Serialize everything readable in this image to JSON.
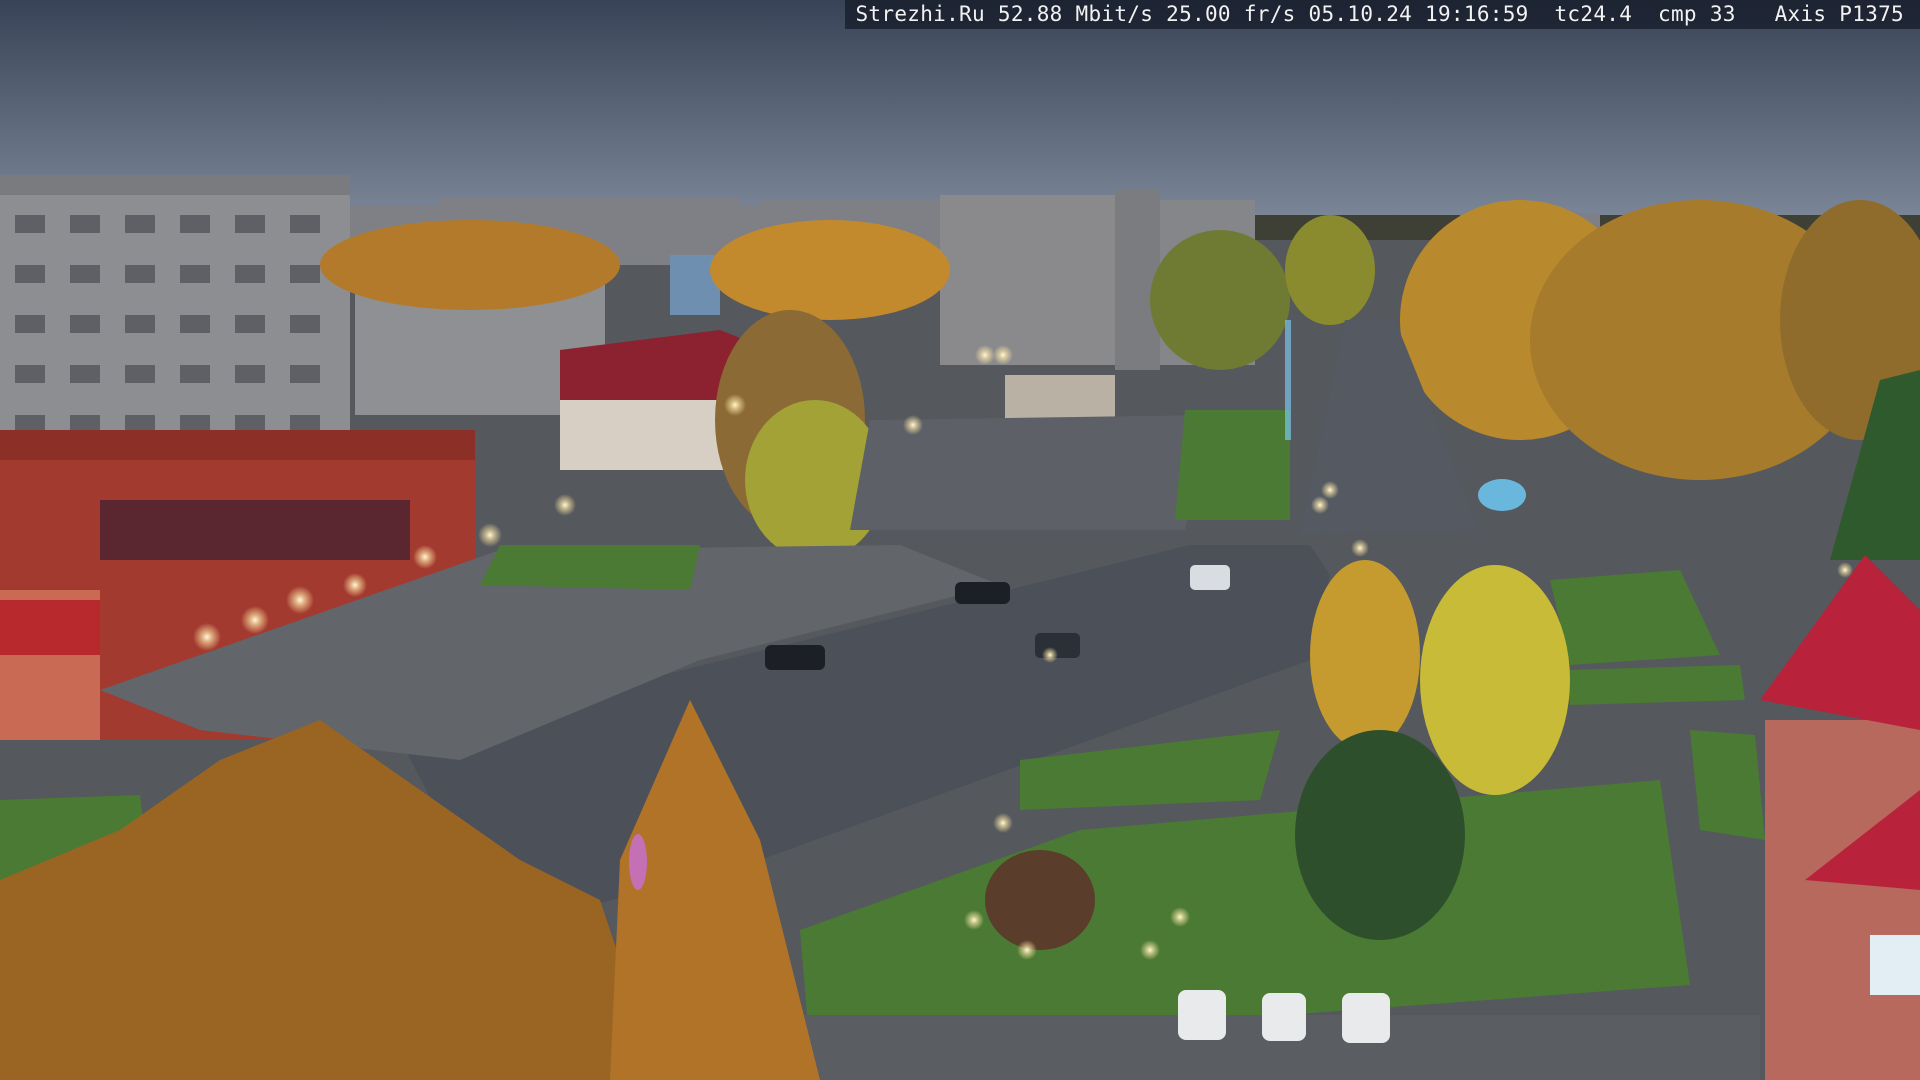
{
  "camera_overlay": {
    "site": "Strezhi.Ru",
    "bitrate": "52.88 Mbit/s",
    "framerate": "25.00 fr/s",
    "date": "05.10.24",
    "time": "19:16:59",
    "tc": "tc24.4",
    "cmp": "cmp 33",
    "model": "Axis P1375"
  },
  "scene": {
    "description_tags": [
      "dusk",
      "autumn-trees",
      "apartment-blocks",
      "avenue",
      "town-square",
      "parked-cars"
    ],
    "palette": {
      "sky_top": "#3a4458",
      "sky_bottom": "#7d8899",
      "asphalt": "#4b4f57",
      "grass": "#4b7a35",
      "foliage_gold": "#c9922a",
      "foliage_orange": "#b06a22",
      "building_grey": "#8e8f93",
      "shop_red": "#a33a2f",
      "roof_red": "#b8233b",
      "lamp": "#fff6d6"
    }
  }
}
